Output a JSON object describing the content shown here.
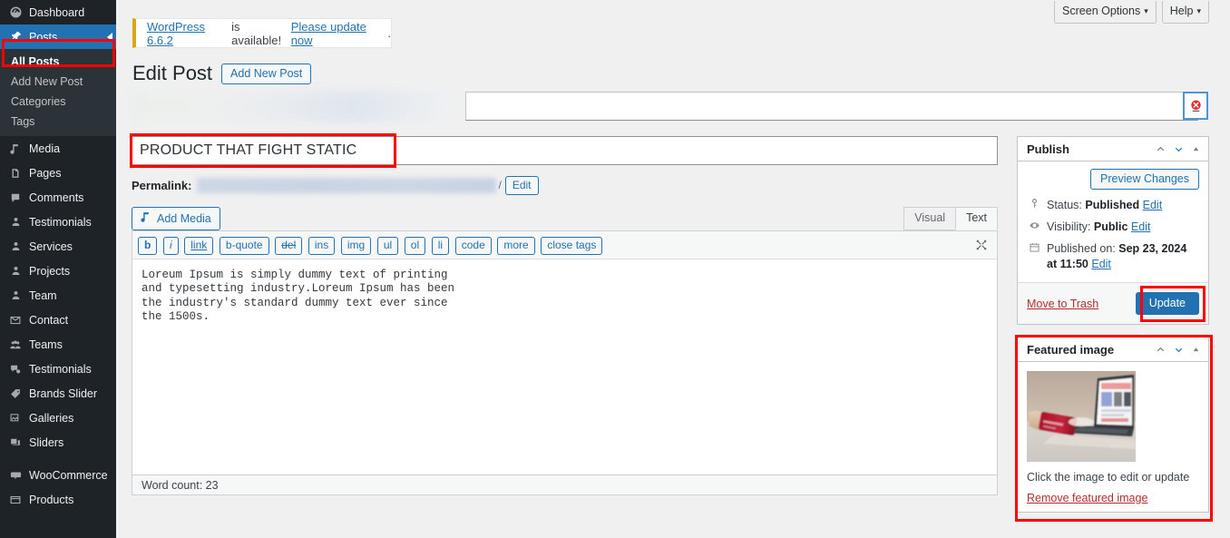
{
  "sidebar": {
    "items": [
      {
        "label": "Dashboard",
        "icon": "dashboard-icon",
        "current": false
      },
      {
        "label": "Posts",
        "icon": "pin-icon",
        "current": true
      },
      {
        "label": "Media",
        "icon": "media-icon",
        "current": false
      },
      {
        "label": "Pages",
        "icon": "pages-icon",
        "current": false
      },
      {
        "label": "Comments",
        "icon": "comment-icon",
        "current": false
      },
      {
        "label": "Testimonials",
        "icon": "user-icon",
        "current": false
      },
      {
        "label": "Services",
        "icon": "user-icon",
        "current": false
      },
      {
        "label": "Projects",
        "icon": "user-icon",
        "current": false
      },
      {
        "label": "Team",
        "icon": "user-icon",
        "current": false
      },
      {
        "label": "Contact",
        "icon": "envelope-icon",
        "current": false
      },
      {
        "label": "Teams",
        "icon": "groups-icon",
        "current": false
      },
      {
        "label": "Testimonials",
        "icon": "testimonial-icon",
        "current": false
      },
      {
        "label": "Brands Slider",
        "icon": "tag-icon",
        "current": false
      },
      {
        "label": "Galleries",
        "icon": "gallery-icon",
        "current": false
      },
      {
        "label": "Sliders",
        "icon": "slider-icon",
        "current": false
      },
      {
        "label": "WooCommerce",
        "icon": "woocommerce-icon",
        "current": false
      },
      {
        "label": "Products",
        "icon": "products-icon",
        "current": false
      }
    ],
    "posts_submenu": [
      {
        "label": "All Posts",
        "current": true
      },
      {
        "label": "Add New Post",
        "current": false
      },
      {
        "label": "Categories",
        "current": false
      },
      {
        "label": "Tags",
        "current": false
      }
    ]
  },
  "screen_meta": {
    "screen_options": "Screen Options",
    "help": "Help",
    "caret": "▾"
  },
  "notice": {
    "link_version": "WordPress 6.6.2",
    "middle_text": " is available! ",
    "link_update": "Please update now",
    "period": "."
  },
  "header": {
    "title": "Edit Post",
    "add_new": "Add New Post"
  },
  "post": {
    "title": "PRODUCT THAT FIGHT STATIC",
    "permalink_label": "Permalink:",
    "permalink_tail": "/",
    "permalink_edit": "Edit",
    "add_media": "Add Media",
    "tabs": {
      "visual": "Visual",
      "text": "Text",
      "active": "Text"
    },
    "quicktags": [
      "b",
      "i",
      "link",
      "b-quote",
      "del",
      "ins",
      "img",
      "ul",
      "ol",
      "li",
      "code",
      "more",
      "close tags"
    ],
    "content": "Loreum Ipsum is simply dummy text of printing\nand typesetting industry.Loreum Ipsum has been\nthe industry's standard dummy text ever since\nthe 1500s.",
    "word_count": "Word count: 23"
  },
  "publish_box": {
    "title": "Publish",
    "preview_changes": "Preview Changes",
    "status_label": "Status:",
    "status_value": "Published",
    "status_edit": "Edit",
    "visibility_label": "Visibility:",
    "visibility_value": "Public",
    "visibility_edit": "Edit",
    "published_label": "Published on:",
    "published_value": "Sep 23, 2024 at 11:50",
    "published_edit": "Edit",
    "move_to_trash": "Move to Trash",
    "update": "Update"
  },
  "featured_box": {
    "title": "Featured image",
    "caption": "Click the image to edit or update",
    "remove": "Remove featured image"
  },
  "colors": {
    "wp_blue": "#2271b1",
    "sidebar_bg": "#1d2327",
    "submenu_bg": "#2c3338",
    "annotation_red": "#ff0000",
    "notice_accent": "#dba617",
    "trash_red": "#b32d2e"
  }
}
